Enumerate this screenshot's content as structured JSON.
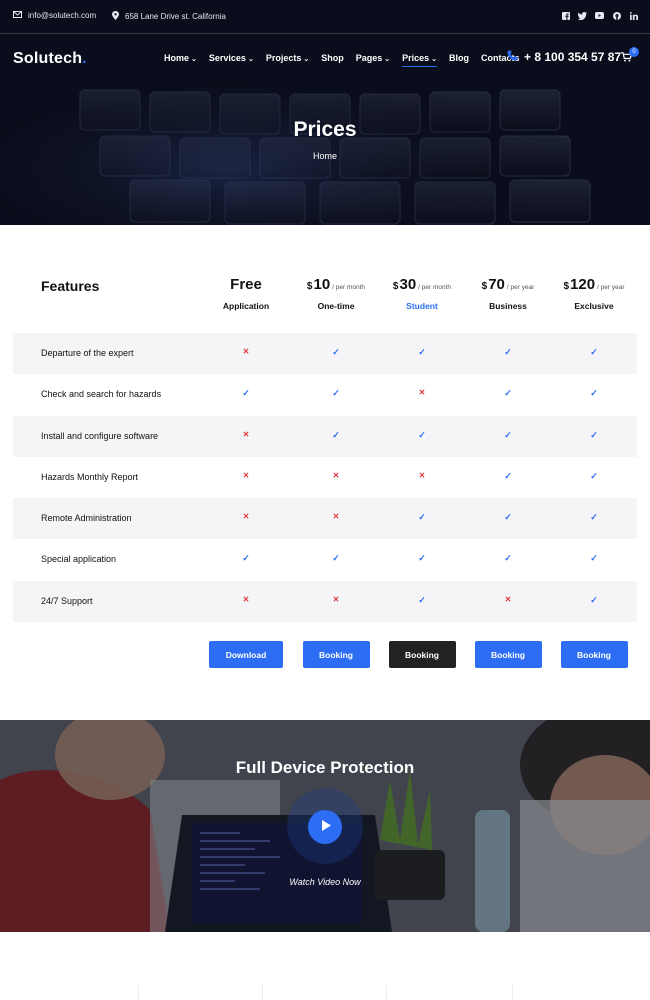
{
  "topbar": {
    "email": "info@solutech.com",
    "address": "658 Lane Drive st. California",
    "socials": [
      "facebook-icon",
      "twitter-icon",
      "youtube-icon",
      "github-icon",
      "linkedin-icon"
    ]
  },
  "nav": {
    "logo": "Solutech",
    "logo_dot": ".",
    "items": [
      {
        "label": "Home",
        "dropdown": true
      },
      {
        "label": "Services",
        "dropdown": true
      },
      {
        "label": "Projects",
        "dropdown": true
      },
      {
        "label": "Shop",
        "dropdown": false
      },
      {
        "label": "Pages",
        "dropdown": true
      },
      {
        "label": "Prices",
        "dropdown": true,
        "active": true
      },
      {
        "label": "Blog",
        "dropdown": false
      },
      {
        "label": "Contacts",
        "dropdown": false
      }
    ],
    "phone": "+ 8 100 354 57 87",
    "cart_count": "0"
  },
  "hero": {
    "title": "Prices",
    "breadcrumb": "Home"
  },
  "pricing": {
    "features_title": "Features",
    "plans": [
      {
        "currency": "",
        "amount": "Free",
        "period": "",
        "name": "Application",
        "highlight": false
      },
      {
        "currency": "$",
        "amount": "10",
        "period": "/ per month",
        "name": "One-time",
        "highlight": false
      },
      {
        "currency": "$",
        "amount": "30",
        "period": "/ per month",
        "name": "Student",
        "highlight": true
      },
      {
        "currency": "$",
        "amount": "70",
        "period": "/ per year",
        "name": "Business",
        "highlight": false
      },
      {
        "currency": "$",
        "amount": "120",
        "period": "/ per year",
        "name": "Exclusive",
        "highlight": false
      }
    ],
    "features": [
      {
        "name": "Departure of the expert",
        "values": [
          false,
          true,
          true,
          true,
          true
        ]
      },
      {
        "name": "Check and search for hazards",
        "values": [
          true,
          true,
          false,
          true,
          true
        ]
      },
      {
        "name": "Install and configure software",
        "values": [
          false,
          true,
          true,
          true,
          true
        ]
      },
      {
        "name": "Hazards Monthly Report",
        "values": [
          false,
          false,
          false,
          true,
          true
        ]
      },
      {
        "name": "Remote Administration",
        "values": [
          false,
          false,
          true,
          true,
          true
        ]
      },
      {
        "name": "Special application",
        "values": [
          true,
          true,
          true,
          true,
          true
        ]
      },
      {
        "name": "24/7 Support",
        "values": [
          false,
          false,
          true,
          false,
          true
        ]
      }
    ],
    "buttons": [
      {
        "label": "Download",
        "dark": false
      },
      {
        "label": "Booking",
        "dark": false
      },
      {
        "label": "Booking",
        "dark": true
      },
      {
        "label": "Booking",
        "dark": false
      },
      {
        "label": "Booking",
        "dark": false
      }
    ]
  },
  "video": {
    "title": "Full Device Protection",
    "watch_label": "Watch Video Now"
  },
  "colors": {
    "accent": "#2c6df4",
    "cross": "#e0393e",
    "dark_button": "#222222",
    "row_shade": "#f5f5f7"
  }
}
